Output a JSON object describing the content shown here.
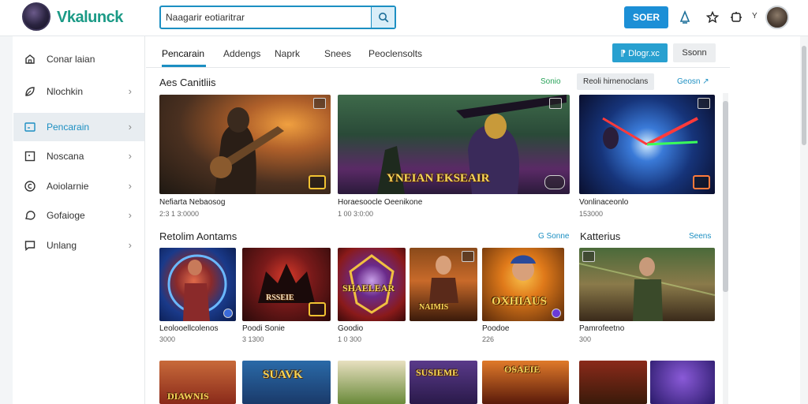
{
  "header": {
    "logo_text": "Vkalunck",
    "search_placeholder": "Naagarir eotiaritrar",
    "search_value": "Naagarir eotiaritrar",
    "action_button": "SOER",
    "user_initial": "Y"
  },
  "sidebar": {
    "items": [
      {
        "label": "Conar laian",
        "icon": "home-icon",
        "chevron": ""
      },
      {
        "label": "Nlochkin",
        "icon": "leaf-icon",
        "chevron": "›"
      },
      {
        "label": "Pencarain",
        "icon": "screen-icon",
        "chevron": "›"
      },
      {
        "label": "Noscana",
        "icon": "square-icon",
        "chevron": "›"
      },
      {
        "label": "Aoiolarnie",
        "icon": "circle-c-icon",
        "chevron": "›"
      },
      {
        "label": "Gofaioge",
        "icon": "chat-icon",
        "chevron": "›"
      },
      {
        "label": "Unlang",
        "icon": "message-icon",
        "chevron": "›"
      }
    ]
  },
  "tabs": {
    "items": [
      "Pencarain",
      "Addengs",
      "Naprk",
      "Snees",
      "Peoclensolts"
    ],
    "primary_button": "⁋ Dlogr.xc",
    "secondary_button": "Ssonn"
  },
  "section1": {
    "title": "Aes Canitliis",
    "chip_green": "Sonio",
    "chip_grey": "Reoli hirnenoclans",
    "chip_blue": "Geosn ↗",
    "cards": [
      {
        "title": "Nefiarta Nebaosog",
        "meta": "2:3 1 3:0000"
      },
      {
        "title": "Horaesoocle Oeenikone",
        "meta": "1 00 3:0:00",
        "cover_text": "YNEIAN EKSEAIR"
      },
      {
        "title": "Vonlinaceonlo",
        "meta": "153000"
      }
    ]
  },
  "section2": {
    "title": "Retolim Aontams",
    "chip_blue": "G Sonne",
    "cards": [
      {
        "title": "Leolooellcolenos",
        "meta": "3000"
      },
      {
        "title": "Poodi Sonie",
        "meta": "3 1300",
        "cover_text": "RSSEIE"
      },
      {
        "title": "Goodio",
        "meta": "1 0 300",
        "cover_text": "SHAELEAR"
      },
      {
        "title": "",
        "meta": "",
        "cover_text": "NAIMIS"
      },
      {
        "title": "Poodoe",
        "meta": "226",
        "cover_text": "OXHIAUS"
      }
    ]
  },
  "section3": {
    "title": "Katterius",
    "chip_blue": "Seens",
    "cards": [
      {
        "title": "Pamrofeetno",
        "meta": "300"
      }
    ]
  },
  "section4": {
    "cover_texts": [
      "DIAWNIS",
      "SUAVK",
      "",
      "SUSIEME",
      "OSAEIE",
      "",
      ""
    ]
  },
  "colors": {
    "accent": "#1c8fc2",
    "brand": "#1b9a86",
    "primary_button": "#28a0d0",
    "header_button": "#1c8fd6"
  }
}
